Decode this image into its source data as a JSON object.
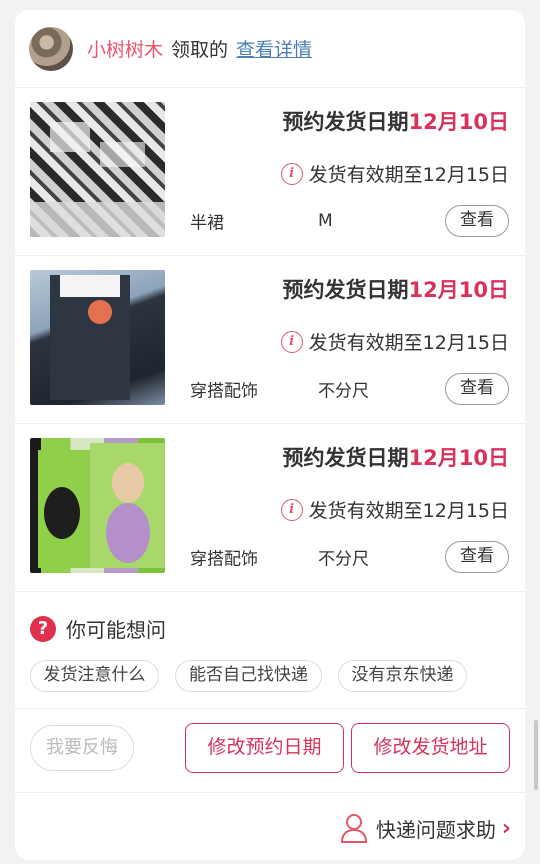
{
  "header": {
    "username": "小树树木",
    "verb": "领取的",
    "detail_link": "查看详情"
  },
  "items": [
    {
      "image_desc": "newspaper-print-skirt",
      "ship_label": "预约发货日期",
      "ship_date": "12月10日",
      "validity": "发货有效期至12月15日",
      "category": "半裙",
      "size": "M",
      "view_label": "查看"
    },
    {
      "image_desc": "black-stockings-package",
      "ship_label": "预约发货日期",
      "ship_date": "12月10日",
      "validity": "发货有效期至12月15日",
      "category": "穿搭配饰",
      "size": "不分尺",
      "view_label": "查看"
    },
    {
      "image_desc": "lingerie-boxes",
      "ship_label": "预约发货日期",
      "ship_date": "12月10日",
      "validity": "发货有效期至12月15日",
      "category": "穿搭配饰",
      "size": "不分尺",
      "view_label": "查看"
    }
  ],
  "faq": {
    "title": "你可能想问",
    "chips": [
      "发货注意什么",
      "能否自己找快递",
      "没有京东快递"
    ]
  },
  "actions": {
    "regret": "我要反悔",
    "modify_date": "修改预约日期",
    "modify_address": "修改发货地址"
  },
  "help": {
    "label": "快递问题求助"
  },
  "colors": {
    "accent": "#d9325a",
    "username": "#e8556c",
    "link": "#4a7fb5",
    "background": "#f2f2f2"
  }
}
